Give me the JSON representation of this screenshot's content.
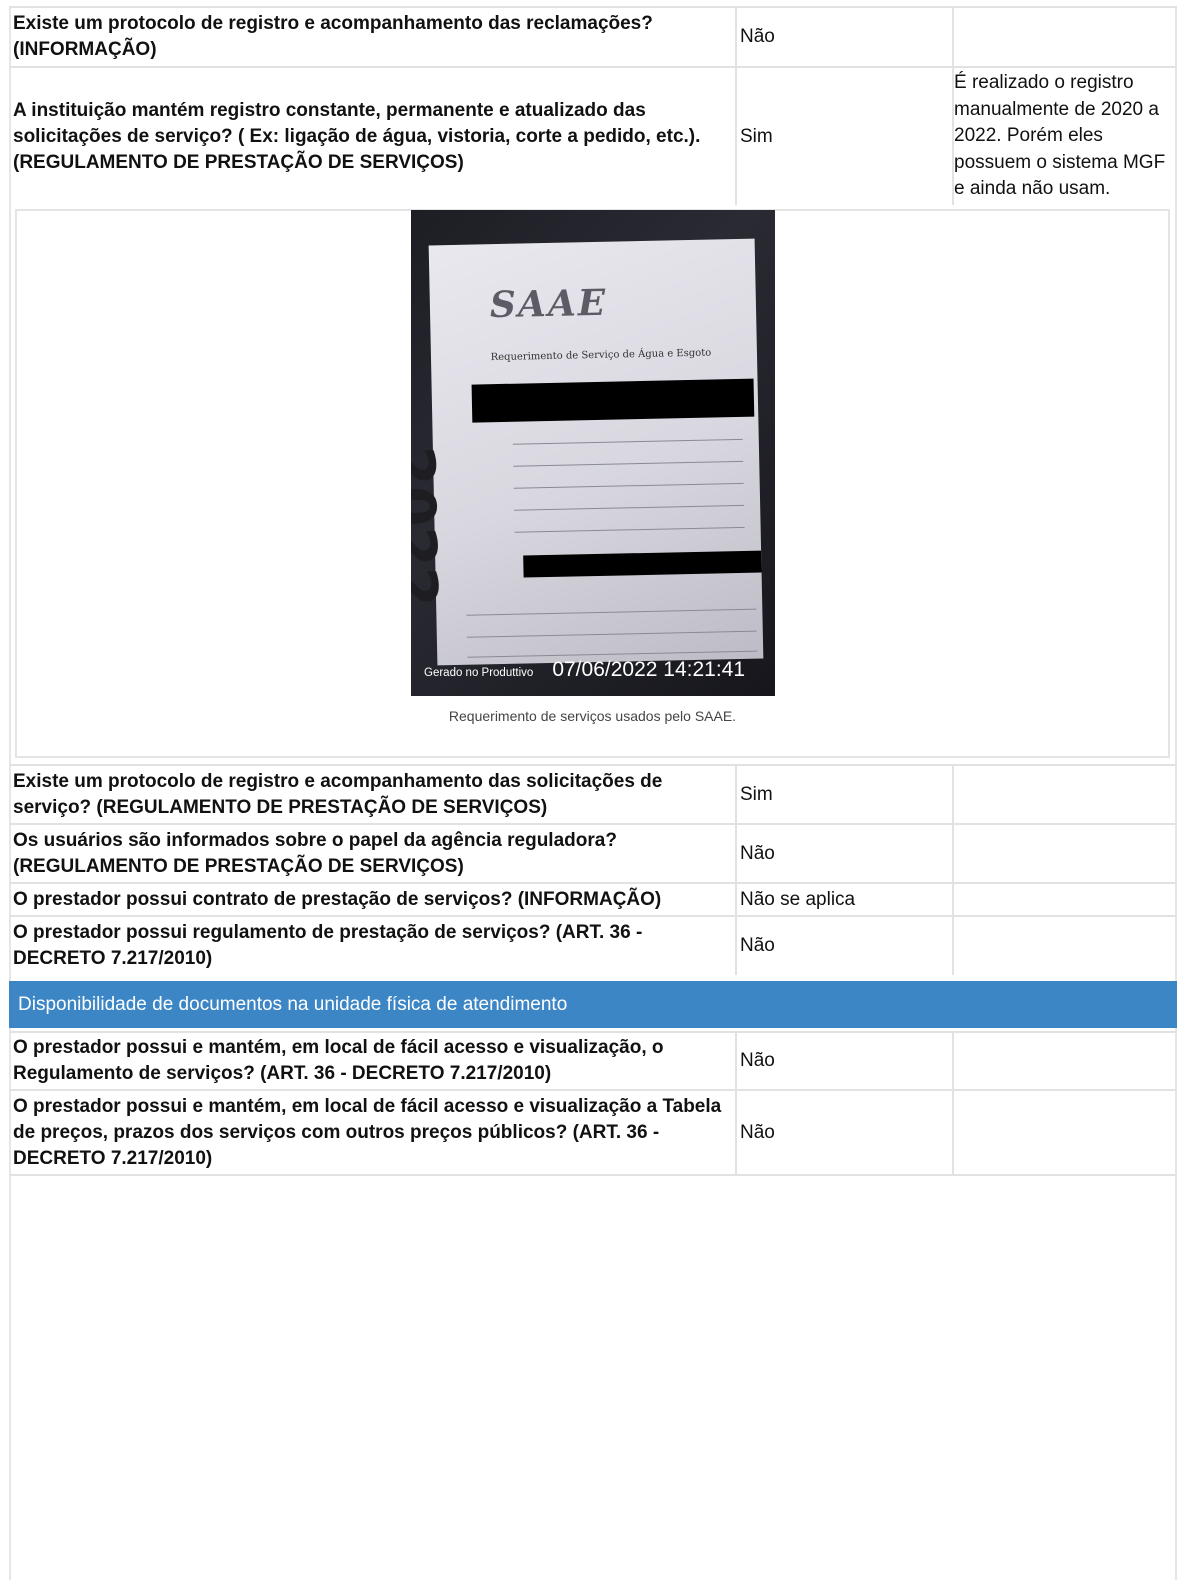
{
  "rows_top": [
    {
      "question": "Existe um protocolo de registro e acompanhamento das reclamações? (INFORMAÇÃO)",
      "answer": "Não",
      "comment": ""
    },
    {
      "question": "A instituição mantém registro constante, permanente e atualizado das solicitações de serviço? ( Ex: ligação de água, vistoria, corte a pedido, etc.). (REGULAMENTO DE PRESTAÇÃO DE SERVIÇOS)",
      "answer": "Sim",
      "comment": "É realizado o registro manualmente de 2020 a 2022. Porém eles possuem o sistema MGF e ainda não usam."
    }
  ],
  "photo": {
    "logo_text": "SAAE",
    "form_title": "Requerimento de Serviço de Água e Esgoto",
    "year_mark": "2022",
    "watermark_app": "Gerado no Produttivo",
    "watermark_datetime": "07/06/2022 14:21:41",
    "caption": "Requerimento de serviços usados pelo SAAE."
  },
  "rows_middle": [
    {
      "question": "Existe um protocolo de registro e acompanhamento das solicitações de serviço? (REGULAMENTO DE PRESTAÇÃO DE SERVIÇOS)",
      "answer": "Sim",
      "comment": ""
    },
    {
      "question": "Os usuários são informados sobre o papel da agência reguladora? (REGULAMENTO DE PRESTAÇÃO DE SERVIÇOS)",
      "answer": "Não",
      "comment": ""
    },
    {
      "question": "O prestador possui contrato de prestação de serviços? (INFORMAÇÃO)",
      "answer": "Não se aplica",
      "comment": ""
    },
    {
      "question": "O prestador possui regulamento de prestação de serviços? (ART. 36 - DECRETO 7.217/2010)",
      "answer": "Não",
      "comment": ""
    }
  ],
  "section_title": "Disponibilidade de documentos na unidade física de atendimento",
  "rows_bottom": [
    {
      "question": "O prestador possui e mantém, em local de fácil acesso e visualização, o Regulamento de serviços? (ART. 36 - DECRETO 7.217/2010)",
      "answer": "Não",
      "comment": ""
    },
    {
      "question": "O prestador possui e mantém, em local de fácil acesso e visualização a Tabela de preços, prazos dos serviços com outros preços públicos? (ART. 36 - DECRETO 7.217/2010)",
      "answer": "Não",
      "comment": ""
    }
  ]
}
